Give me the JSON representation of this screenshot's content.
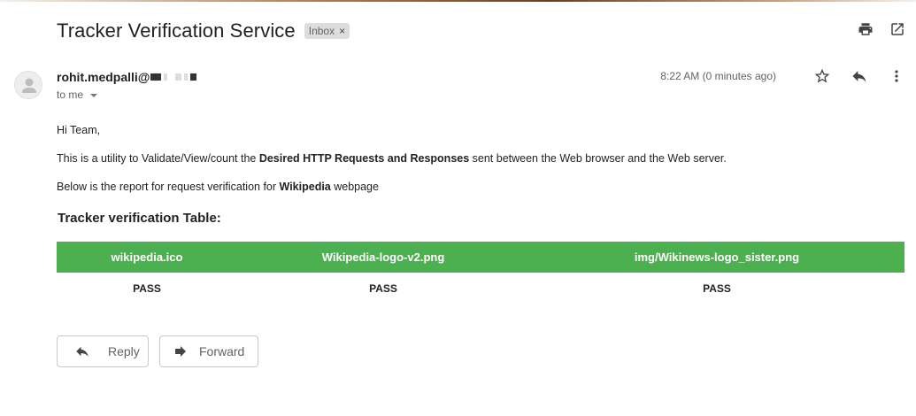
{
  "email": {
    "subject": "Tracker Verification Service",
    "label": "Inbox",
    "label_remove": "×",
    "sender": "rohit.medpalli@",
    "recipient": "to me",
    "timestamp": "8:22 AM (0 minutes ago)"
  },
  "icons": {
    "print": "print-icon",
    "open_new_window": "open-in-new-window-icon",
    "star": "star-icon",
    "reply": "reply-icon",
    "more": "more-vert-icon",
    "avatar": "person-icon",
    "forward": "forward-icon"
  },
  "body": {
    "greeting": "Hi Team,",
    "line2_pre": "This is a utility to Validate/View/count the ",
    "line2_bold": "Desired HTTP Requests and Responses",
    "line2_post": " sent between the Web browser and the Web server.",
    "line3_pre": "Below is the report for request verification for ",
    "line3_bold": "Wikipedia",
    "line3_post": " webpage",
    "table_title": "Tracker verification Table:"
  },
  "table": {
    "headers": [
      "wikipedia.ico",
      "Wikipedia-logo-v2.png",
      "img/Wikinews-logo_sister.png"
    ],
    "rows": [
      [
        "PASS",
        "PASS",
        "PASS"
      ]
    ]
  },
  "actions": {
    "reply": "Reply",
    "forward": "Forward"
  },
  "colors": {
    "table_header": "#4caf50",
    "label_chip": "#dddddd"
  }
}
